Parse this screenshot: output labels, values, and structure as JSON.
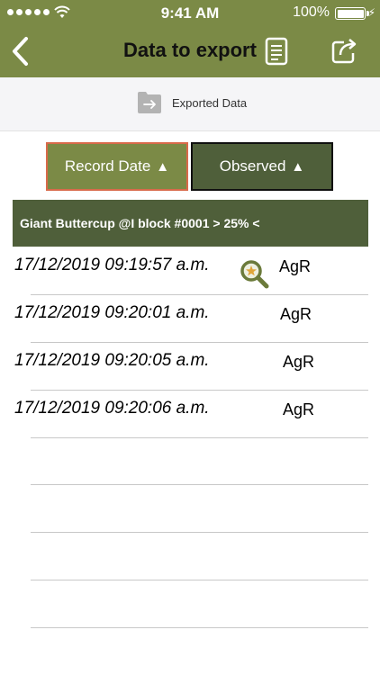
{
  "status_bar": {
    "time": "9:41 AM",
    "battery": "100%"
  },
  "nav": {
    "title": "Data to export",
    "icons": {
      "back": "chevron-left-icon",
      "document": "document-icon",
      "share": "share-icon"
    }
  },
  "export": {
    "label": "Exported Data",
    "icon": "exported-data-icon"
  },
  "sort": {
    "record_date_label": "Record Date",
    "observed_label": "Observed",
    "arrow": "▲"
  },
  "group": {
    "title": "Giant Buttercup @I block #0001 > 25% <"
  },
  "rows": [
    {
      "date": "17/12/2019 09:19:57 a.m.",
      "code": "AgR"
    },
    {
      "date": "17/12/2019 09:20:01 a.m.",
      "code": "AgR"
    },
    {
      "date": "17/12/2019 09:20:05 a.m.",
      "code": "AgR"
    },
    {
      "date": "17/12/2019 09:20:06 a.m.",
      "code": "AgR"
    }
  ],
  "colors": {
    "header_bg": "#7b8a46",
    "dark_green": "#4f5f3a",
    "selected_border": "#d86a4a"
  }
}
